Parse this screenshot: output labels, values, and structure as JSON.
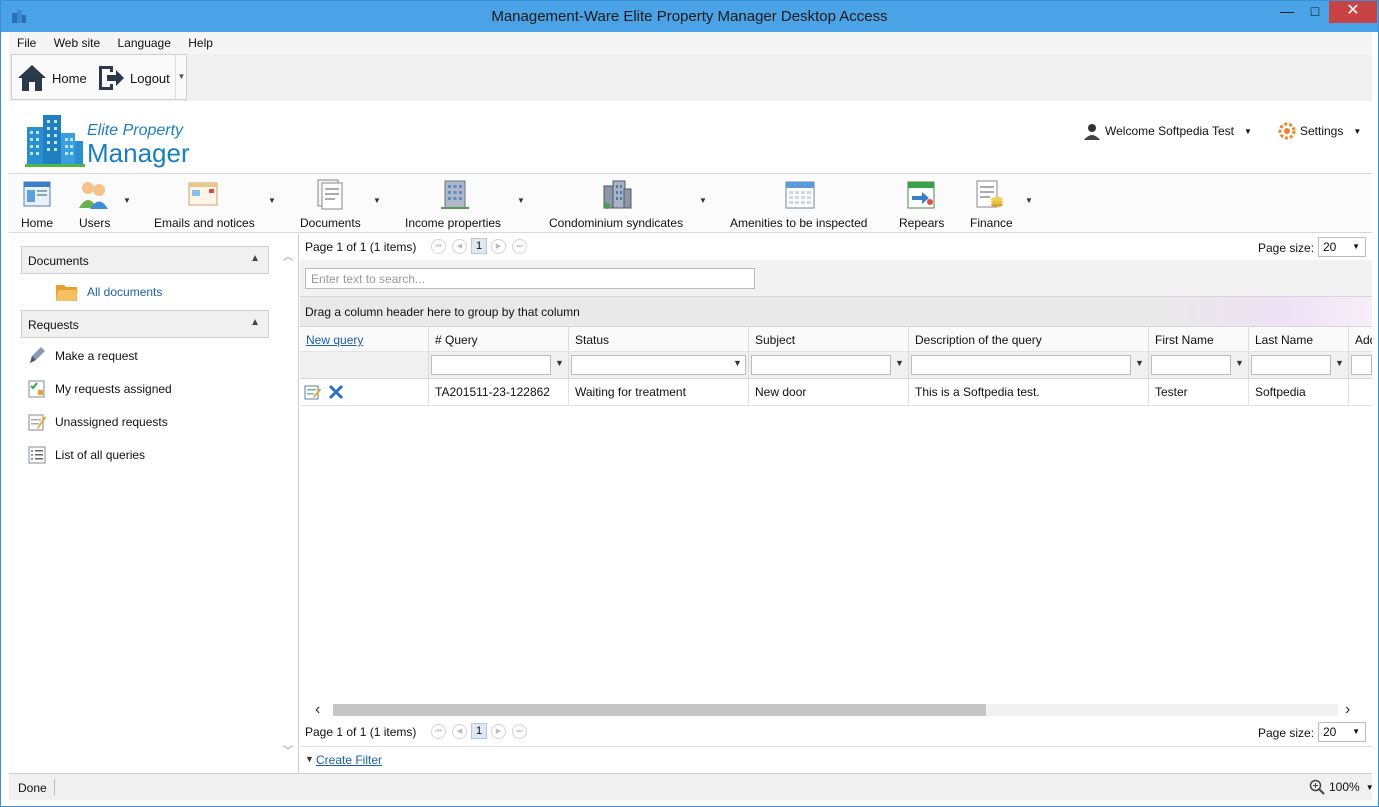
{
  "window": {
    "title": "Management-Ware Elite Property Manager Desktop Access",
    "min": "—",
    "max": "□",
    "close": "✕"
  },
  "menu": [
    "File",
    "Web site",
    "Language",
    "Help"
  ],
  "quickbar": {
    "home": "Home",
    "logout": "Logout"
  },
  "logo": {
    "line1": "Elite Property",
    "line2": "Manager"
  },
  "header": {
    "welcome": "Welcome Softpedia Test",
    "settings": "Settings"
  },
  "ribbon": [
    {
      "label": "Home",
      "icon": "home-page-icon",
      "dropdown": false
    },
    {
      "label": "Users",
      "icon": "users-icon",
      "dropdown": true
    },
    {
      "label": "Emails and notices",
      "icon": "email-window-icon",
      "dropdown": true
    },
    {
      "label": "Documents",
      "icon": "documents-icon",
      "dropdown": true
    },
    {
      "label": "Income properties",
      "icon": "building-icon",
      "dropdown": true
    },
    {
      "label": "Condominium syndicates",
      "icon": "condo-icon",
      "dropdown": true
    },
    {
      "label": "Amenities to be inspected",
      "icon": "calendar-icon",
      "dropdown": false
    },
    {
      "label": "Repears",
      "icon": "repairs-icon",
      "dropdown": false
    },
    {
      "label": "Finance",
      "icon": "finance-icon",
      "dropdown": true
    }
  ],
  "leftpanel": {
    "documents_group": "Documents",
    "all_documents": "All documents",
    "requests_group": "Requests",
    "requests": [
      "Make a request",
      "My requests assigned",
      "Unassigned requests",
      "List of all queries"
    ]
  },
  "pager": {
    "text": "Page 1 of 1 (1 items)",
    "current": "1",
    "size_label": "Page size:",
    "size": "20"
  },
  "search": {
    "placeholder": "Enter text to search..."
  },
  "group_hint": "Drag a column header here to group by that column",
  "columns": [
    "New query",
    "# Query",
    "Status",
    "Subject",
    "Description of the query",
    "First Name",
    "Last Name",
    "Add"
  ],
  "row": {
    "query": "TA201511-23-122862",
    "status": "Waiting for treatment",
    "subject": "New door",
    "description": "This is a Softpedia test.",
    "first_name": "Tester",
    "last_name": "Softpedia"
  },
  "create_filter": "Create Filter",
  "status": {
    "text": "Done",
    "zoom": "100%"
  },
  "colors": {
    "titlebar": "#4aa3e6",
    "close": "#c74343",
    "link": "#1a5fa8",
    "brand": "#1a7fbf"
  }
}
